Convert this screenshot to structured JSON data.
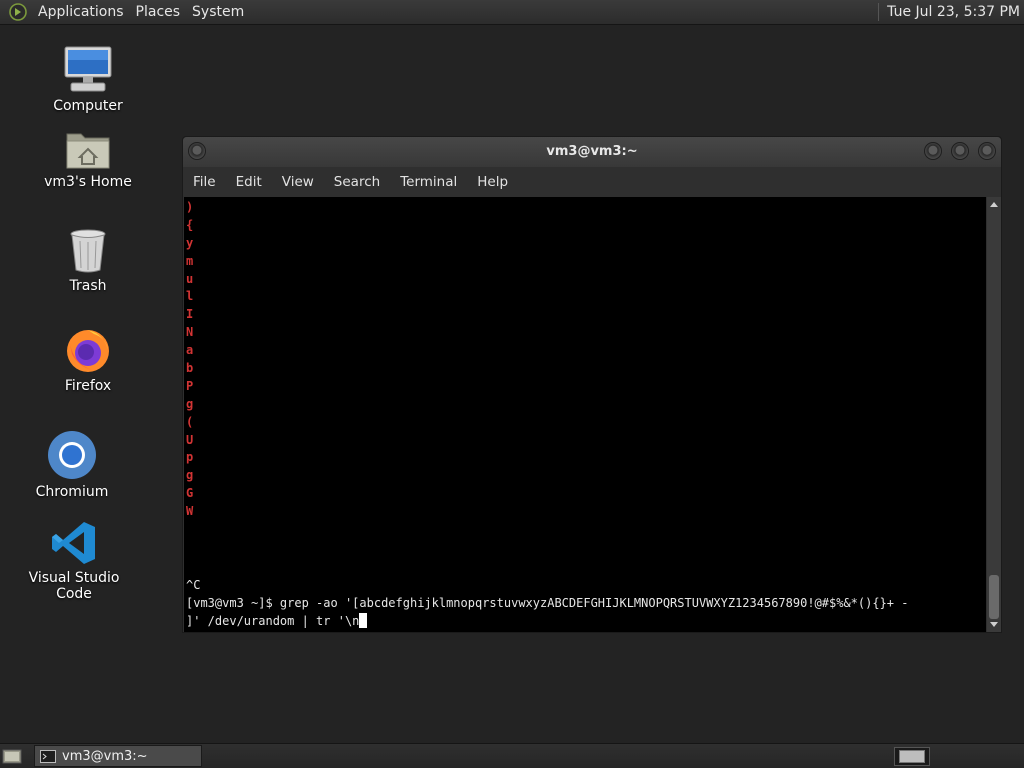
{
  "top_panel": {
    "menus": [
      "Applications",
      "Places",
      "System"
    ],
    "clock": "Tue Jul 23,  5:37 PM"
  },
  "desktop_icons": [
    {
      "label": "Computer",
      "icon": "computer-icon"
    },
    {
      "label": "vm3's Home",
      "icon": "home-folder-icon"
    },
    {
      "label": "Trash",
      "icon": "trash-icon"
    },
    {
      "label": "Firefox",
      "icon": "firefox-icon"
    },
    {
      "label": "Chromium",
      "icon": "chromium-icon"
    },
    {
      "label": "Visual Studio Code",
      "icon": "vscode-icon"
    }
  ],
  "terminal": {
    "title": "vm3@vm3:~",
    "menus": [
      "File",
      "Edit",
      "View",
      "Search",
      "Terminal",
      "Help"
    ],
    "output_chars": [
      ")",
      "{",
      "y",
      "m",
      "u",
      "l",
      "I",
      "N",
      "a",
      "b",
      "P",
      "g",
      "(",
      "U",
      "p",
      "g",
      "G",
      "W"
    ],
    "interrupt": "^C",
    "command_line_1": "[vm3@vm3 ~]$ grep -ao '[abcdefghijklmnopqrstuvwxyzABCDEFGHIJKLMNOPQRSTUVWXYZ1234567890!@#$%&*(){}+ -",
    "command_line_2": "]' /dev/urandom | tr '\\n",
    "output_color": "#d23434"
  },
  "taskbar": {
    "window_label": "vm3@vm3:~"
  }
}
